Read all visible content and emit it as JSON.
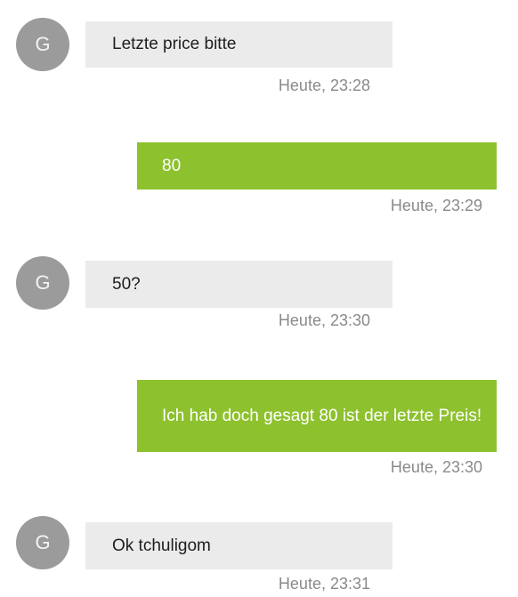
{
  "messages": [
    {
      "direction": "incoming",
      "avatar": "G",
      "text": "Letzte price bitte",
      "time": "Heute, 23:28"
    },
    {
      "direction": "outgoing",
      "text": "80",
      "time": "Heute, 23:29"
    },
    {
      "direction": "incoming",
      "avatar": "G",
      "text": "50?",
      "time": "Heute, 23:30"
    },
    {
      "direction": "outgoing",
      "text": "Ich hab doch gesagt 80 ist der letzte Preis!",
      "time": "Heute, 23:30"
    },
    {
      "direction": "incoming",
      "avatar": "G",
      "text": "Ok tchuligom",
      "time": "Heute, 23:31"
    }
  ],
  "colors": {
    "incoming_bubble": "#ebebeb",
    "outgoing_bubble": "#8dc12e",
    "avatar": "#9b9b9b",
    "timestamp": "#8a8a8a"
  }
}
